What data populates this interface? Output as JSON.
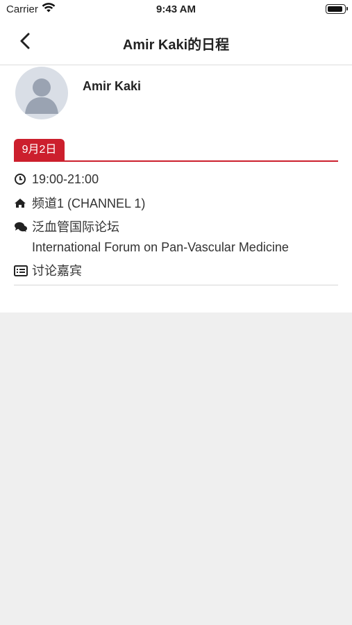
{
  "status_bar": {
    "carrier": "Carrier",
    "time": "9:43 AM"
  },
  "nav": {
    "title": "Amir Kaki的日程"
  },
  "speaker": {
    "name": "Amir Kaki"
  },
  "date_tab": "9月2日",
  "session": {
    "time": "19:00-21:00",
    "channel": "频道1 (CHANNEL 1)",
    "forum_cn": "泛血管国际论坛",
    "forum_en": "International Forum on Pan-Vascular Medicine",
    "role": "讨论嘉宾"
  },
  "colors": {
    "accent": "#cc1f2d",
    "background": "#efefef"
  }
}
